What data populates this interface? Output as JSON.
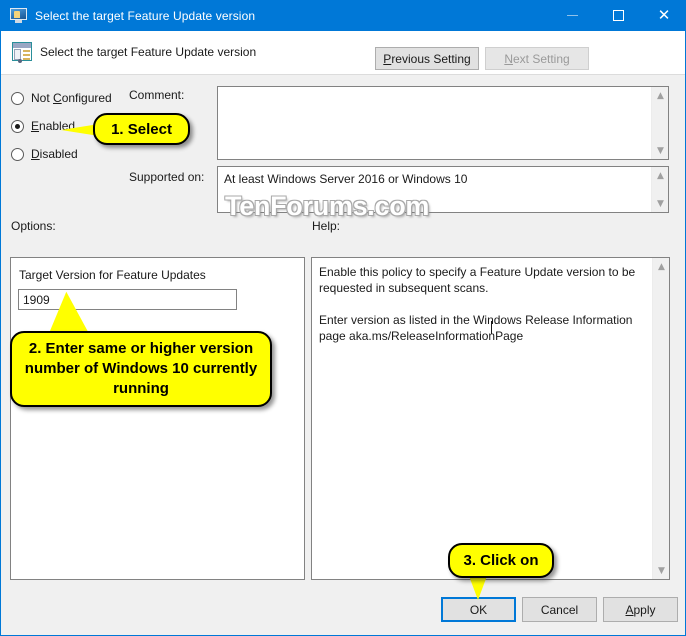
{
  "window": {
    "title": "Select the target Feature Update version",
    "icon": "computer-monitor-icon",
    "controls": {
      "minimize": "minimize-icon",
      "maximize": "maximize-icon",
      "close": "close-icon"
    }
  },
  "header": {
    "icon": "group-policy-setting-icon",
    "title": "Select the target Feature Update version",
    "previous_setting": "Previous Setting",
    "previous_setting_accel": "P",
    "next_setting": "Next Setting",
    "next_setting_accel": "N",
    "next_setting_disabled": true
  },
  "state": {
    "options": [
      {
        "label": "Not Configured",
        "accel": "C",
        "selected": false
      },
      {
        "label": "Enabled",
        "accel": "E",
        "selected": true
      },
      {
        "label": "Disabled",
        "accel": "D",
        "selected": false
      }
    ]
  },
  "comment": {
    "label": "Comment:",
    "value": ""
  },
  "supported": {
    "label": "Supported on:",
    "value": "At least Windows Server 2016 or Windows 10"
  },
  "panels": {
    "options_label": "Options:",
    "help_label": "Help:"
  },
  "options_panel": {
    "field_label": "Target Version for Feature Updates",
    "field_value": "1909",
    "field_placeholder": ""
  },
  "help_panel": {
    "text": "Enable this policy to specify a Feature Update version to be requested in subsequent scans.\n\nEnter version as listed in the Windows Release Information page aka.ms/ReleaseInformationPage"
  },
  "buttons": {
    "ok": "OK",
    "cancel": "Cancel",
    "apply": "Apply",
    "apply_accel": "A"
  },
  "watermark": "TenForums.com",
  "callouts": [
    {
      "text": "1. Select"
    },
    {
      "text": "2. Enter same or higher version number of Windows 10 currently running"
    },
    {
      "text": "3. Click on"
    }
  ],
  "colors": {
    "titlebar": "#0078d7",
    "callout_fill": "#ffff00",
    "focus_border": "#0078d7",
    "dialog_bg": "#f0f0f0"
  }
}
